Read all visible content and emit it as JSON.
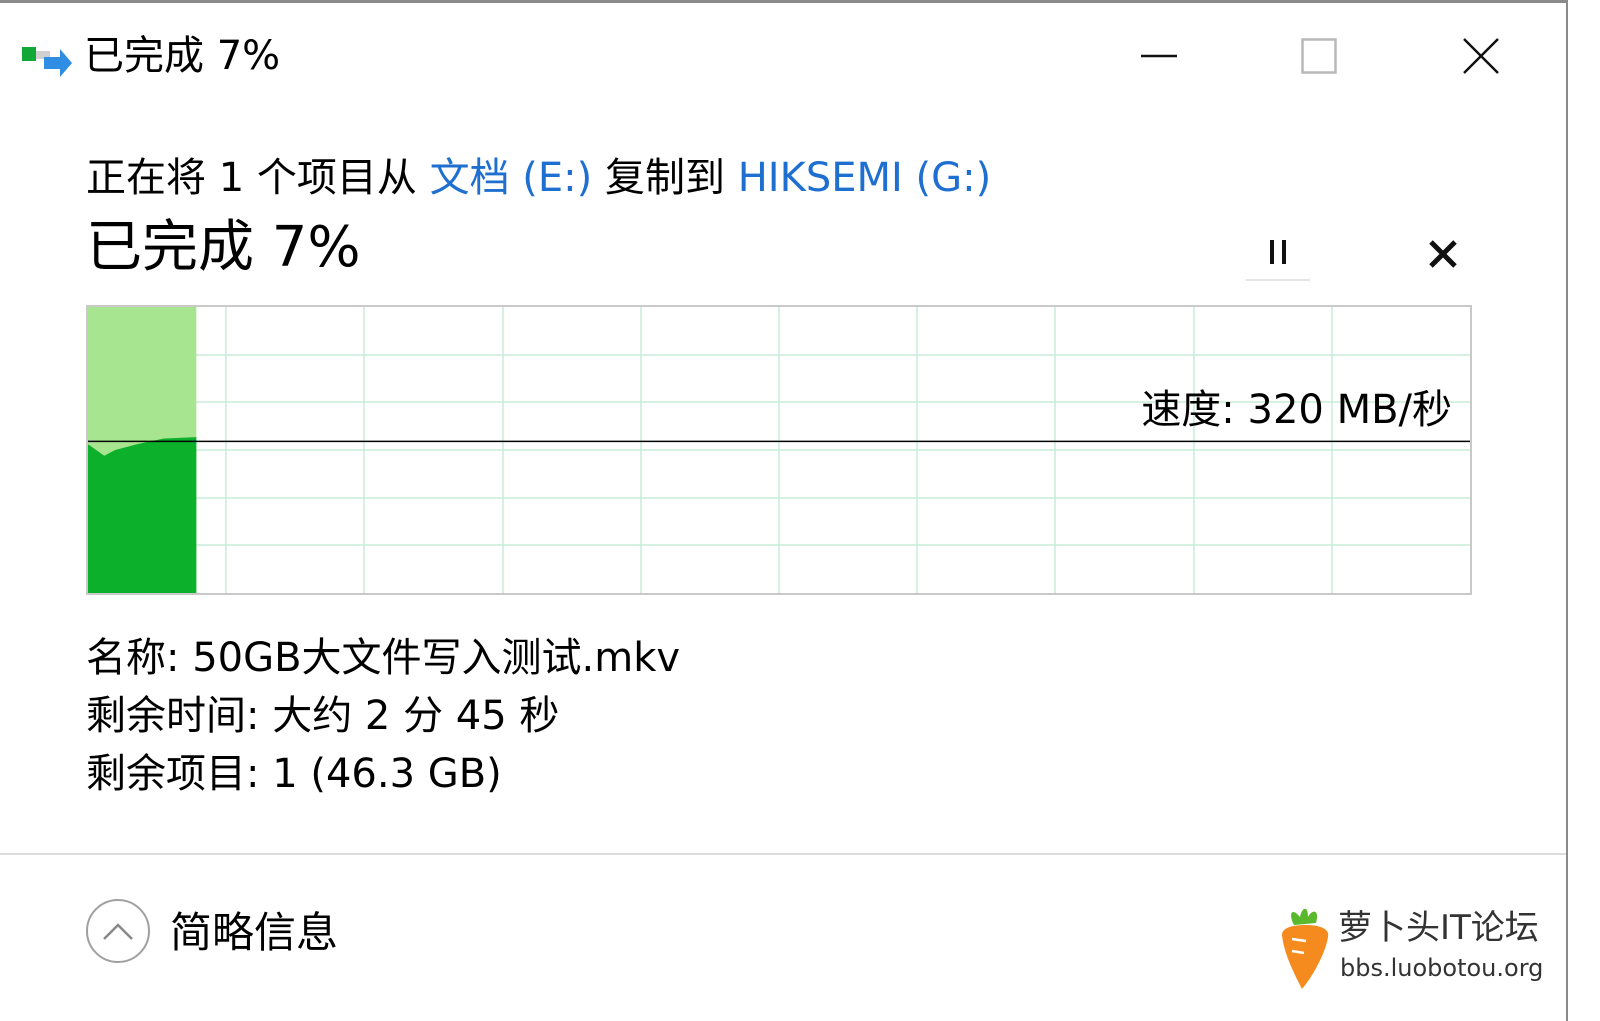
{
  "window": {
    "title": "已完成 7%",
    "icon": "file-copy-icon"
  },
  "copy": {
    "prefix": "正在将 1 个项目从 ",
    "source": "文档 (E:)",
    "middle": " 复制到 ",
    "destination": "HIKSEMI (G:)",
    "progress_label": "已完成 7%",
    "progress_percent": 7
  },
  "graph": {
    "speed_label": "速度: 320 MB/秒",
    "colors": {
      "fill": "#0db02b",
      "fill_light": "#a8e590",
      "grid": "#c9ecd7",
      "speed_line": "#000000"
    }
  },
  "details": {
    "name": "名称: 50GB大文件写入测试.mkv",
    "time_remaining": "剩余时间: 大约 2 分 45 秒",
    "items_remaining": "剩余项目: 1 (46.3 GB)"
  },
  "footer": {
    "collapse_label": "简略信息"
  },
  "watermark": {
    "title": "萝卜头IT论坛",
    "url": "bbs.luobotou.org"
  }
}
